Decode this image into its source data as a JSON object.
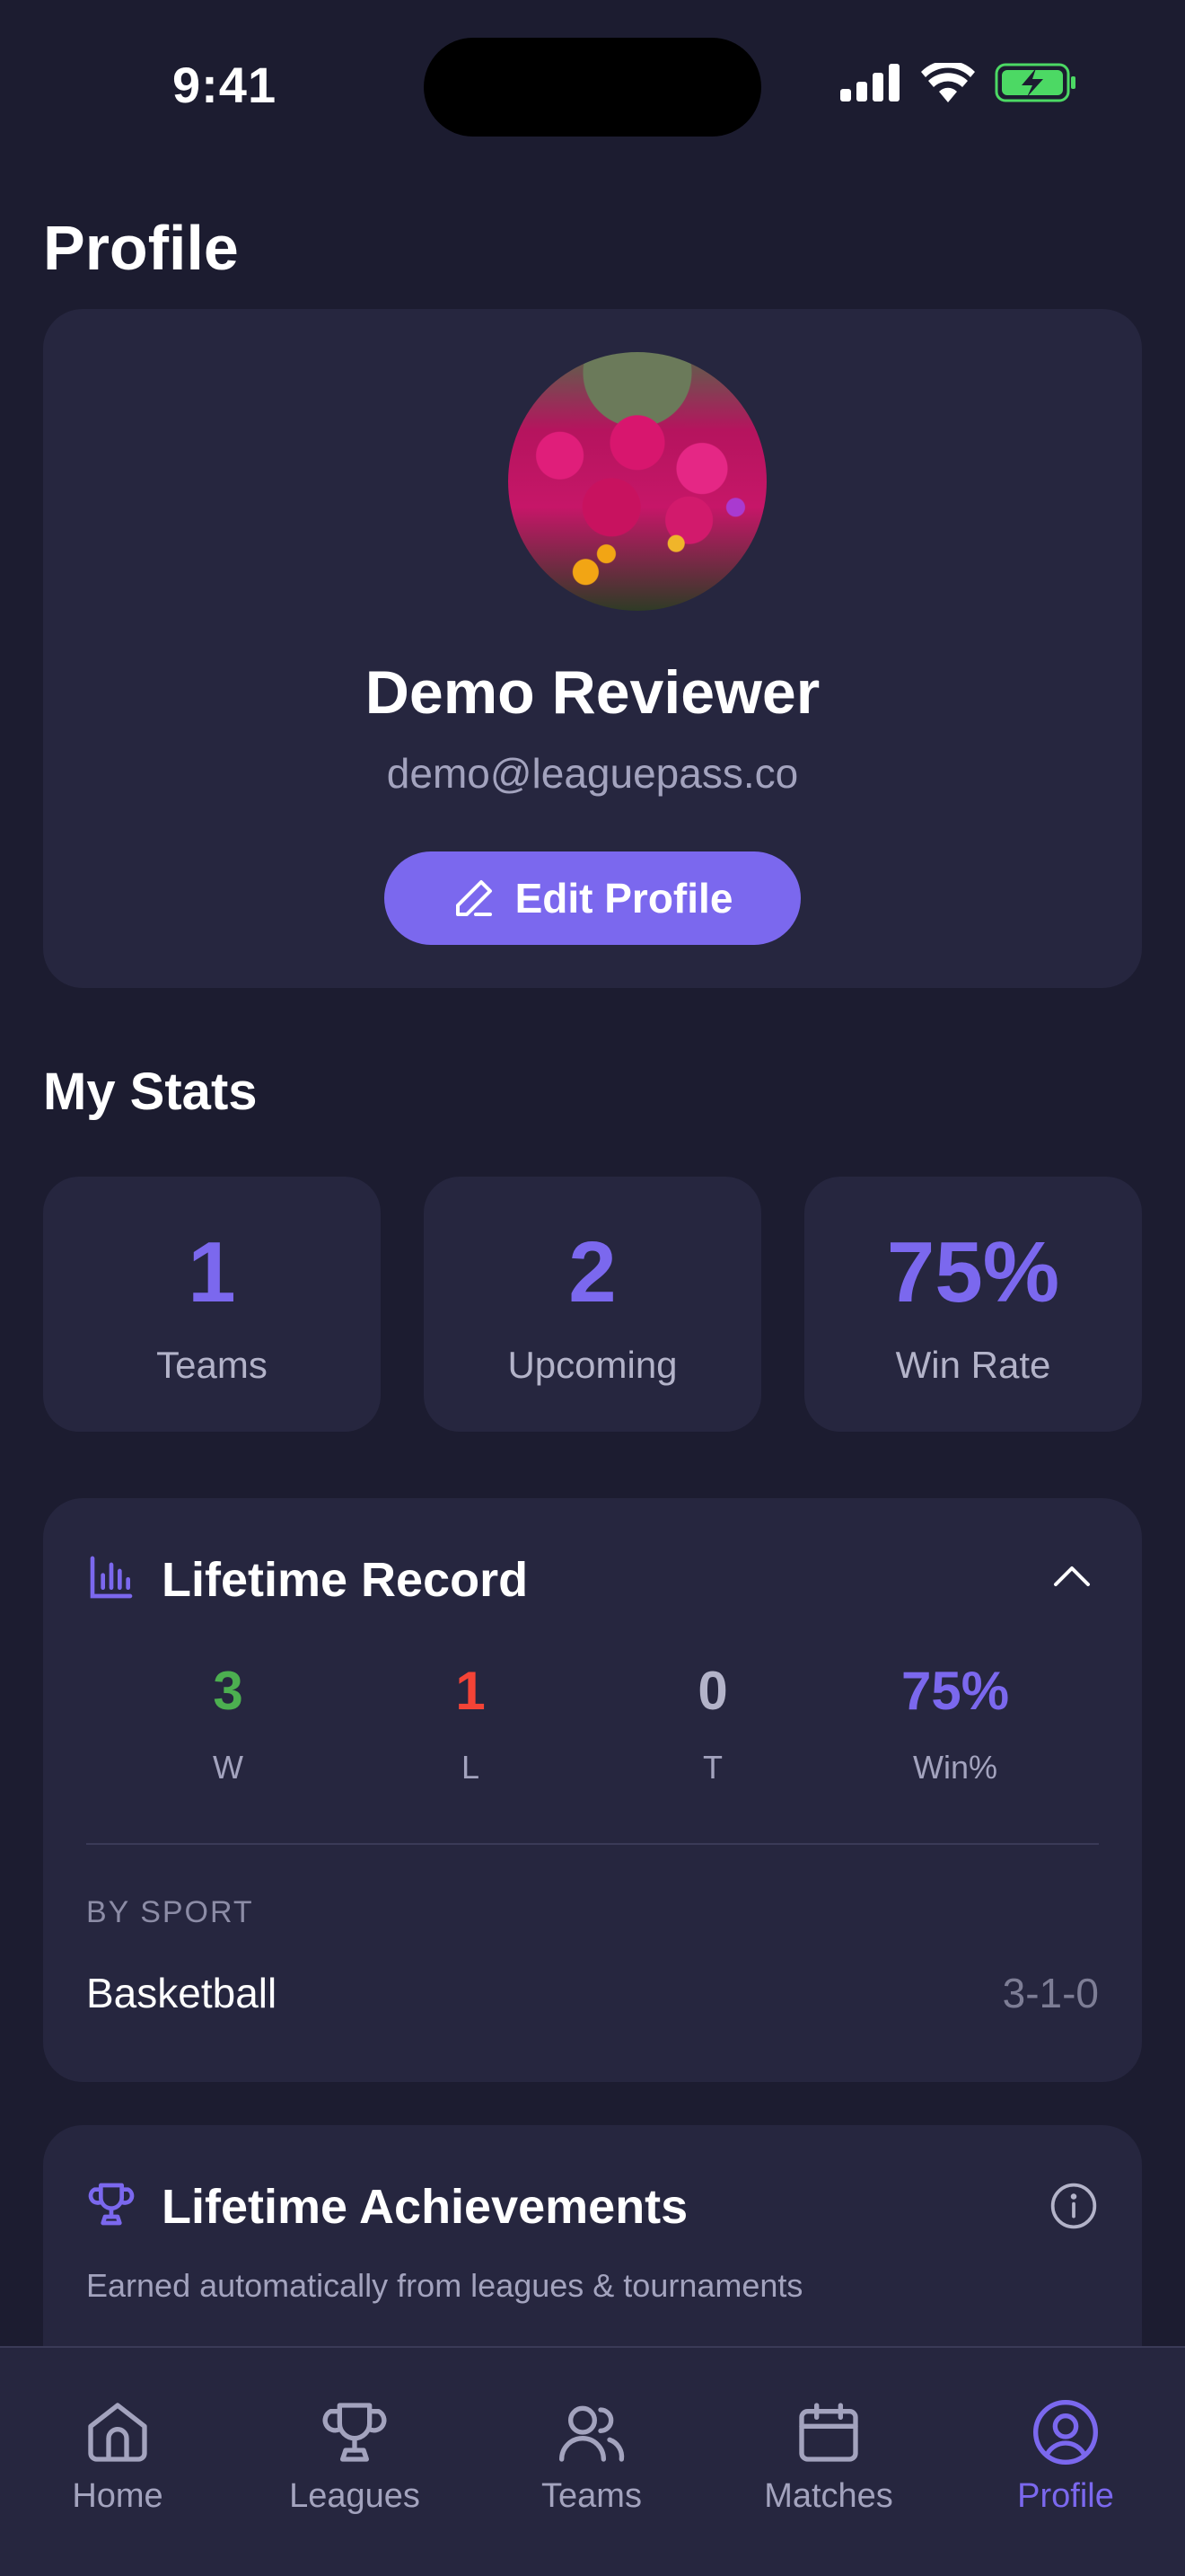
{
  "status_bar": {
    "time": "9:41"
  },
  "page_title": "Profile",
  "profile": {
    "name": "Demo Reviewer",
    "email": "demo@leaguepass.co",
    "edit_label": "Edit Profile"
  },
  "stats": {
    "title": "My Stats",
    "items": [
      {
        "value": "1",
        "label": "Teams"
      },
      {
        "value": "2",
        "label": "Upcoming"
      },
      {
        "value": "75%",
        "label": "Win Rate"
      }
    ]
  },
  "lifetime_record": {
    "title": "Lifetime Record",
    "columns": [
      {
        "value": "3",
        "label": "W",
        "color": "#4caf50"
      },
      {
        "value": "1",
        "label": "L",
        "color": "#f44336"
      },
      {
        "value": "0",
        "label": "T",
        "color": "#b3b3c9"
      },
      {
        "value": "75%",
        "label": "Win%",
        "color": "#7b68ee"
      }
    ],
    "by_sport_label": "BY SPORT",
    "sports": [
      {
        "name": "Basketball",
        "record": "3-1-0"
      }
    ]
  },
  "achievements": {
    "title": "Lifetime Achievements",
    "subtitle": "Earned automatically from leagues & tournaments"
  },
  "tab_bar": {
    "tabs": [
      {
        "label": "Home",
        "icon": "home-icon"
      },
      {
        "label": "Leagues",
        "icon": "trophy-icon"
      },
      {
        "label": "Teams",
        "icon": "users-icon"
      },
      {
        "label": "Matches",
        "icon": "calendar-icon"
      },
      {
        "label": "Profile",
        "icon": "profile-icon",
        "active": true
      }
    ]
  },
  "colors": {
    "accent": "#7b68ee",
    "background": "#1c1c30",
    "card": "#26263f"
  }
}
